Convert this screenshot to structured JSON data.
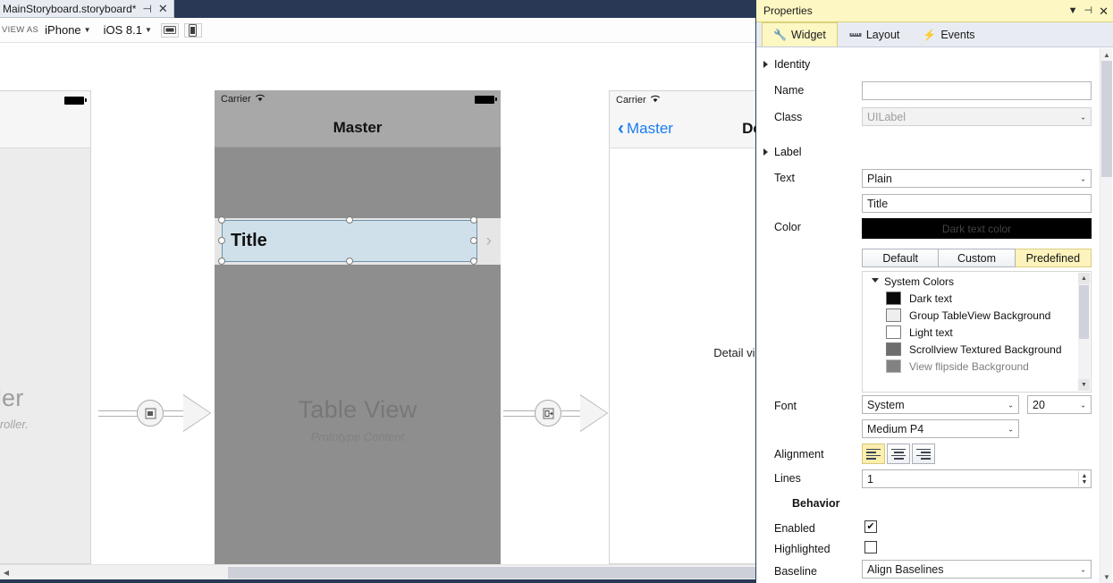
{
  "designer": {
    "tab": {
      "title": "MainStoryboard.storyboard*",
      "pin_icon": "pin-icon",
      "close_icon": "close-icon"
    },
    "toolbar": {
      "view_as_label": "VIEW AS",
      "device": "iPhone",
      "os_version": "iOS 8.1",
      "landscape_icon": "landscape-orientation-icon",
      "portrait_icon": "portrait-orientation-icon"
    },
    "nav_controller": {
      "title": "troller",
      "subtitle": "iew controller."
    },
    "master": {
      "carrier": "Carrier",
      "wifi_icon": "wifi-icon",
      "title": "Master",
      "cell_label": "Title",
      "disclosure_icon": "chevron-right-icon",
      "tableview_title": "Table View",
      "tableview_subtitle": "Prototype Content"
    },
    "detail": {
      "carrier": "Carrier",
      "wifi_icon": "wifi-icon",
      "back_label": "Master",
      "back_icon": "chevron-left-icon",
      "title": "De",
      "body": "Detail view con"
    },
    "scrollbar": {
      "left_arrow": "scroll-left-arrow"
    }
  },
  "properties": {
    "pad_title": "Properties",
    "pad_buttons": {
      "dropdown": "chevron-down-icon",
      "pin": "pin-icon",
      "close": "close-icon"
    },
    "tabs": [
      {
        "label": "Widget",
        "icon": "wrench-icon",
        "active": true
      },
      {
        "label": "Layout",
        "icon": "ruler-icon",
        "active": false
      },
      {
        "label": "Events",
        "icon": "lightning-icon",
        "active": false
      }
    ],
    "identity": {
      "section": "Identity",
      "name_label": "Name",
      "name_value": "",
      "class_label": "Class",
      "class_value": "UILabel"
    },
    "label_section": {
      "section": "Label",
      "text_label": "Text",
      "text_type": "Plain",
      "text_value": "Title",
      "color_label": "Color",
      "color_swatch_text": "Dark text color",
      "color_swatch_hex": "#000000",
      "color_modes": [
        {
          "label": "Default",
          "active": false
        },
        {
          "label": "Custom",
          "active": false
        },
        {
          "label": "Predefined",
          "active": true
        }
      ],
      "system_colors_header": "System Colors",
      "system_colors": [
        {
          "label": "Dark text",
          "hex": "#0a0a0a"
        },
        {
          "label": "Group TableView Background",
          "hex": "#eeeeee"
        },
        {
          "label": "Light text",
          "hex": "#ffffff"
        },
        {
          "label": "Scrollview Textured Background",
          "hex": "#6e6e6e"
        },
        {
          "label": "View flipside Background",
          "hex": "#1d1d1d"
        }
      ],
      "font_label": "Font",
      "font_family": "System",
      "font_size": "20",
      "font_style": "Medium P4",
      "alignment_label": "Alignment",
      "alignment_options": [
        {
          "name": "align-left",
          "active": true
        },
        {
          "name": "align-center",
          "active": false
        },
        {
          "name": "align-right",
          "active": false
        }
      ],
      "lines_label": "Lines",
      "lines_value": "1"
    },
    "behavior": {
      "section": "Behavior",
      "enabled_label": "Enabled",
      "enabled_checked": "✔",
      "highlighted_label": "Highlighted",
      "highlighted_checked": "",
      "baseline_label": "Baseline",
      "baseline_value": "Align Baselines"
    }
  }
}
